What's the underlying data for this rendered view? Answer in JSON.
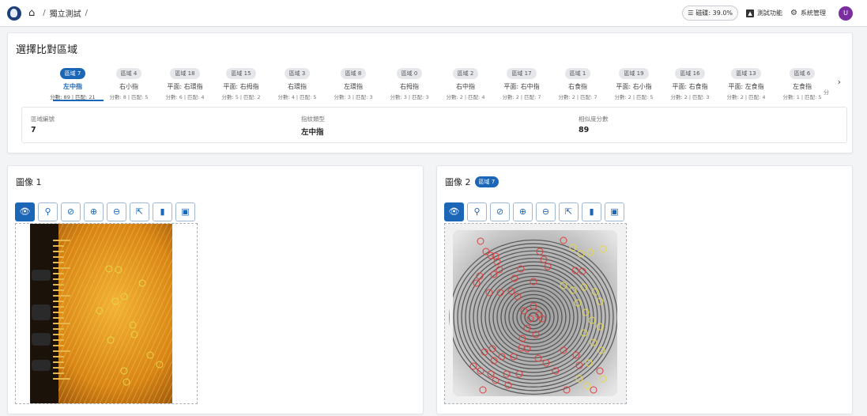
{
  "topbar": {
    "breadcrumb_sep": "/",
    "breadcrumb_current": "獨立測試",
    "breadcrumb_trailing": "/",
    "status_pill": "磁碟: 39.0%",
    "test_feature": "測試功能",
    "system_admin": "系統管理",
    "user_initial": "U"
  },
  "regions": {
    "title": "選擇比對區域",
    "tabs": [
      {
        "chip": "區域 7",
        "name": "左中指",
        "meta": "分數: 89 | 匹配: 21"
      },
      {
        "chip": "區域 4",
        "name": "右小指",
        "meta": "分數: 8 | 匹配: 5"
      },
      {
        "chip": "區域 18",
        "name": "平面: 右環指",
        "meta": "分數: 6 | 匹配: 4"
      },
      {
        "chip": "區域 15",
        "name": "平面: 右拇指",
        "meta": "分數: 5 | 匹配: 2"
      },
      {
        "chip": "區域 3",
        "name": "右環指",
        "meta": "分數: 4 | 匹配: 5"
      },
      {
        "chip": "區域 8",
        "name": "左環指",
        "meta": "分數: 3 | 匹配: 3"
      },
      {
        "chip": "區域 0",
        "name": "右拇指",
        "meta": "分數: 3 | 匹配: 3"
      },
      {
        "chip": "區域 2",
        "name": "右中指",
        "meta": "分數: 2 | 匹配: 4"
      },
      {
        "chip": "區域 17",
        "name": "平面: 右中指",
        "meta": "分數: 2 | 匹配: 7"
      },
      {
        "chip": "區域 1",
        "name": "右食指",
        "meta": "分數: 2 | 匹配: 7"
      },
      {
        "chip": "區域 19",
        "name": "平面: 右小指",
        "meta": "分數: 2 | 匹配: 5"
      },
      {
        "chip": "區域 16",
        "name": "平面: 右食指",
        "meta": "分數: 2 | 匹配: 3"
      },
      {
        "chip": "區域 13",
        "name": "平面: 左食指",
        "meta": "分數: 2 | 匹配: 4"
      },
      {
        "chip": "區域 6",
        "name": "左食指",
        "meta": "分數: 1 | 匹配: 5"
      }
    ],
    "overflow_text": "分",
    "info": {
      "region_label": "區域編號",
      "region_value": "7",
      "type_label": "指紋類型",
      "type_value": "左中指",
      "score_label": "相似度分數",
      "score_value": "89"
    }
  },
  "image1": {
    "title": "圖像 1"
  },
  "image2": {
    "title": "圖像 2",
    "badge": "區域 7"
  },
  "toolbar_icons": [
    "eye-icon",
    "zoom-region-icon",
    "eye-off-icon",
    "zoom-in-icon",
    "zoom-out-icon",
    "fullscreen-icon",
    "delete-icon",
    "save-icon"
  ],
  "colors": {
    "accent": "#1c66b8",
    "avatar": "#7b2ea0",
    "minutia_matched": "#e03c3c",
    "minutia_other": "#e6d84a"
  }
}
